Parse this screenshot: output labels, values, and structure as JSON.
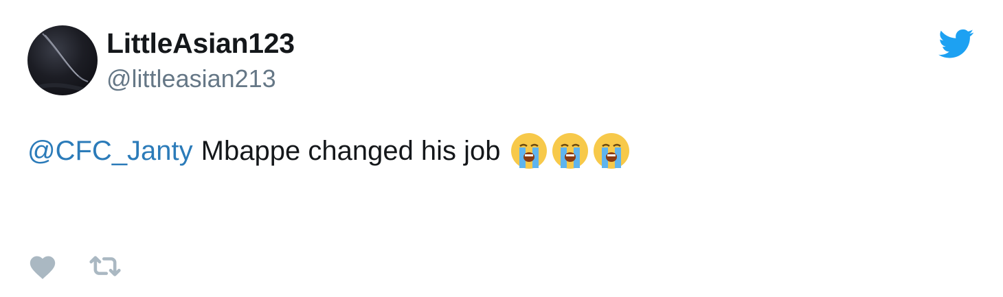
{
  "tweet": {
    "author": {
      "display_name": "LittleAsian123",
      "handle": "@littleasian213",
      "avatar_icon": "avatar-image"
    },
    "mention": "@CFC_Janty",
    "text": "Mbappe changed his job",
    "emojis": [
      "loudly-crying-face",
      "loudly-crying-face",
      "loudly-crying-face"
    ],
    "brand_icon": "twitter-bird-icon",
    "actions": [
      {
        "name": "like",
        "icon": "heart-icon"
      },
      {
        "name": "retweet",
        "icon": "retweet-icon"
      }
    ]
  },
  "colors": {
    "brand": "#1da1f2",
    "mention": "#2b7bb9",
    "handle": "#657786",
    "action_icon": "#aab8c2"
  }
}
